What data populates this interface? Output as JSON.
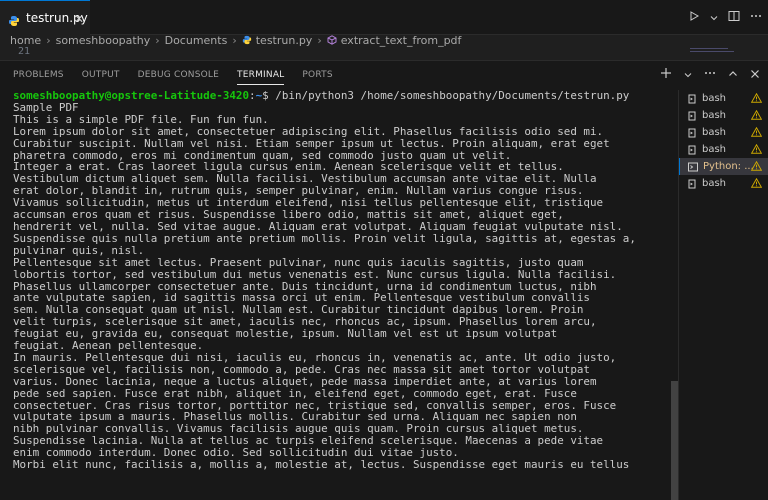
{
  "tab": {
    "label": "testrun.py",
    "close": "✕"
  },
  "breadcrumb": [
    "home",
    "someshboopathy",
    "Documents",
    "testrun.py",
    "extract_text_from_pdf"
  ],
  "editor": {
    "line_number": "21"
  },
  "panel": {
    "tabs": [
      "PROBLEMS",
      "OUTPUT",
      "DEBUG CONSOLE",
      "TERMINAL",
      "PORTS"
    ],
    "active_tab": "TERMINAL"
  },
  "terminal": {
    "prompt_user": "someshboopathy@opstree-Latitude-3420",
    "prompt_sep": ":",
    "prompt_path": "~",
    "prompt_cmd": "$ /bin/python3 /home/someshboopathy/Documents/testrun.py",
    "lines": [
      "Sample PDF",
      "This is a simple PDF file. Fun fun fun.",
      "Lorem ipsum dolor sit amet, consectetuer adipiscing elit. Phasellus facilisis odio sed mi.",
      "Curabitur suscipit. Nullam vel nisi. Etiam semper ipsum ut lectus. Proin aliquam, erat eget",
      "pharetra commodo, eros mi condimentum quam, sed commodo justo quam ut velit.",
      "Integer a erat. Cras laoreet ligula cursus enim. Aenean scelerisque velit et tellus.",
      "Vestibulum dictum aliquet sem. Nulla facilisi. Vestibulum accumsan ante vitae elit. Nulla",
      "erat dolor, blandit in, rutrum quis, semper pulvinar, enim. Nullam varius congue risus.",
      "Vivamus sollicitudin, metus ut interdum eleifend, nisi tellus pellentesque elit, tristique",
      "accumsan eros quam et risus. Suspendisse libero odio, mattis sit amet, aliquet eget,",
      "hendrerit vel, nulla. Sed vitae augue. Aliquam erat volutpat. Aliquam feugiat vulputate nisl.",
      "Suspendisse quis nulla pretium ante pretium mollis. Proin velit ligula, sagittis at, egestas a,",
      "pulvinar quis, nisl.",
      "Pellentesque sit amet lectus. Praesent pulvinar, nunc quis iaculis sagittis, justo quam",
      "lobortis tortor, sed vestibulum dui metus venenatis est. Nunc cursus ligula. Nulla facilisi.",
      "Phasellus ullamcorper consectetuer ante. Duis tincidunt, urna id condimentum luctus, nibh",
      "ante vulputate sapien, id sagittis massa orci ut enim. Pellentesque vestibulum convallis",
      "sem. Nulla consequat quam ut nisl. Nullam est. Curabitur tincidunt dapibus lorem. Proin",
      "velit turpis, scelerisque sit amet, iaculis nec, rhoncus ac, ipsum. Phasellus lorem arcu,",
      "feugiat eu, gravida eu, consequat molestie, ipsum. Nullam vel est ut ipsum volutpat",
      "feugiat. Aenean pellentesque.",
      "In mauris. Pellentesque dui nisi, iaculis eu, rhoncus in, venenatis ac, ante. Ut odio justo,",
      "scelerisque vel, facilisis non, commodo a, pede. Cras nec massa sit amet tortor volutpat",
      "varius. Donec lacinia, neque a luctus aliquet, pede massa imperdiet ante, at varius lorem",
      "pede sed sapien. Fusce erat nibh, aliquet in, eleifend eget, commodo eget, erat. Fusce",
      "consectetuer. Cras risus tortor, porttitor nec, tristique sed, convallis semper, eros. Fusce",
      "vulputate ipsum a mauris. Phasellus mollis. Curabitur sed urna. Aliquam nec sapien non",
      "nibh pulvinar convallis. Vivamus facilisis augue quis quam. Proin cursus aliquet metus.",
      "Suspendisse lacinia. Nulla at tellus ac turpis eleifend scelerisque. Maecenas a pede vitae",
      "enim commodo interdum. Donec odio. Sed sollicitudin dui vitae justo.",
      "Morbi elit nunc, facilisis a, mollis a, molestie at, lectus. Suspendisse eget mauris eu tellus"
    ]
  },
  "terminal_list": [
    {
      "label": "bash",
      "icon": "terminal-icon",
      "warning": true,
      "active": false
    },
    {
      "label": "bash",
      "icon": "terminal-icon",
      "warning": true,
      "active": false
    },
    {
      "label": "bash",
      "icon": "terminal-icon",
      "warning": true,
      "active": false
    },
    {
      "label": "bash",
      "icon": "terminal-icon",
      "warning": true,
      "active": false
    },
    {
      "label": "Python: ...",
      "icon": "python-debug-icon",
      "warning": true,
      "active": true
    },
    {
      "label": "bash",
      "icon": "terminal-icon",
      "warning": true,
      "active": false
    }
  ],
  "colors": {
    "accent": "#0078d4",
    "prompt_user": "#16c60c",
    "prompt_path": "#3b8eea",
    "warning": "#cca700",
    "python_label": "#e2c08d"
  }
}
